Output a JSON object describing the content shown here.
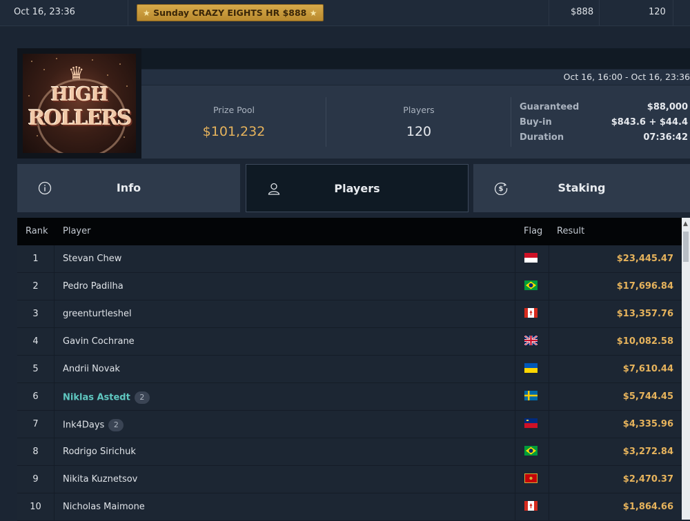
{
  "top_row": {
    "date": "Oct 16, 23:36",
    "tournament": "Sunday CRAZY EIGHTS HR $888",
    "prize": "$888",
    "players": "120"
  },
  "header": {
    "time_range": "Oct 16, 16:00 - Oct 16, 23:36",
    "logo_text_1": "HIGH",
    "logo_text_2": "ROLLERS",
    "prize_pool_label": "Prize Pool",
    "prize_pool_value": "$101,232",
    "players_label": "Players",
    "players_value": "120",
    "details": [
      {
        "label": "Guaranteed",
        "value": "$88,000"
      },
      {
        "label": "Buy-in",
        "value": "$843.6 + $44.4"
      },
      {
        "label": "Duration",
        "value": "07:36:42"
      }
    ],
    "colors": {
      "accent_gold": "#e6b35c",
      "highlight_player": "#5fc7c0"
    }
  },
  "tabs": [
    {
      "label": "Info",
      "icon": "info-icon",
      "active": false
    },
    {
      "label": "Players",
      "icon": "user-icon",
      "active": true
    },
    {
      "label": "Staking",
      "icon": "dollar-coin-icon",
      "active": false
    }
  ],
  "table": {
    "headers": {
      "rank": "Rank",
      "player": "Player",
      "flag": "Flag",
      "result": "Result"
    },
    "rows": [
      {
        "rank": "1",
        "player": "Stevan Chew",
        "count": "",
        "flag": "indonesia",
        "result": "$23,445.47"
      },
      {
        "rank": "2",
        "player": "Pedro Padilha",
        "count": "",
        "flag": "brazil",
        "result": "$17,696.84"
      },
      {
        "rank": "3",
        "player": "greenturtleshel",
        "count": "",
        "flag": "canada",
        "result": "$13,357.76"
      },
      {
        "rank": "4",
        "player": "Gavin Cochrane",
        "count": "",
        "flag": "uk",
        "result": "$10,082.58"
      },
      {
        "rank": "5",
        "player": "Andrii Novak",
        "count": "",
        "flag": "ukraine",
        "result": "$7,610.44"
      },
      {
        "rank": "6",
        "player": "Niklas Astedt",
        "count": "2",
        "flag": "sweden",
        "result": "$5,744.45",
        "highlight": true
      },
      {
        "rank": "7",
        "player": "Ink4Days",
        "count": "2",
        "flag": "liechtenstein",
        "result": "$4,335.96"
      },
      {
        "rank": "8",
        "player": "Rodrigo Sirichuk",
        "count": "",
        "flag": "brazil",
        "result": "$3,272.84"
      },
      {
        "rank": "9",
        "player": "Nikita Kuznetsov",
        "count": "",
        "flag": "montenegro",
        "result": "$2,470.37"
      },
      {
        "rank": "10",
        "player": "Nicholas Maimone",
        "count": "",
        "flag": "canada",
        "result": "$1,864.66"
      }
    ]
  }
}
